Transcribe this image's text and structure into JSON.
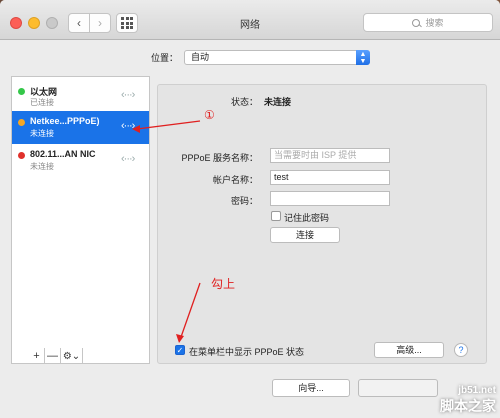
{
  "window": {
    "title": "网络",
    "search_placeholder": "搜索"
  },
  "location": {
    "label": "位置：",
    "value": "自动"
  },
  "services": [
    {
      "name": "以太网",
      "status": "已连接",
      "dot_color": "#34c749",
      "selected": false
    },
    {
      "name": "Netkee...PPPoE)",
      "status": "未连接",
      "dot_color": "#f5a623",
      "selected": true
    },
    {
      "name": "802.11...AN NIC",
      "status": "未连接",
      "dot_color": "#e0312b",
      "selected": false
    }
  ],
  "sidebar_tools": {
    "add": "+",
    "remove": "—",
    "gear": "⚙⌄"
  },
  "detail": {
    "status_label": "状态：",
    "status_value": "未连接",
    "service_name_label": "PPPoE 服务名称：",
    "service_name_placeholder": "当需要时由 ISP 提供",
    "account_label": "帐户名称：",
    "account_value": "test",
    "password_label": "密码：",
    "password_value": "",
    "remember_label": "记住此密码",
    "connect_button": "连接",
    "show_in_menubar_label": "在菜单栏中显示 PPPoE 状态",
    "show_in_menubar_checked": true,
    "advanced_button": "高级...",
    "help": "?"
  },
  "footer": {
    "assistant_button": "向导..."
  },
  "annotations": {
    "circle_one": "①",
    "check_it": "勾上"
  },
  "watermark": {
    "site": "jb51.net",
    "name": "脚本之家"
  },
  "colors": {
    "accent": "#1a73e8",
    "annotation": "#e02020"
  }
}
